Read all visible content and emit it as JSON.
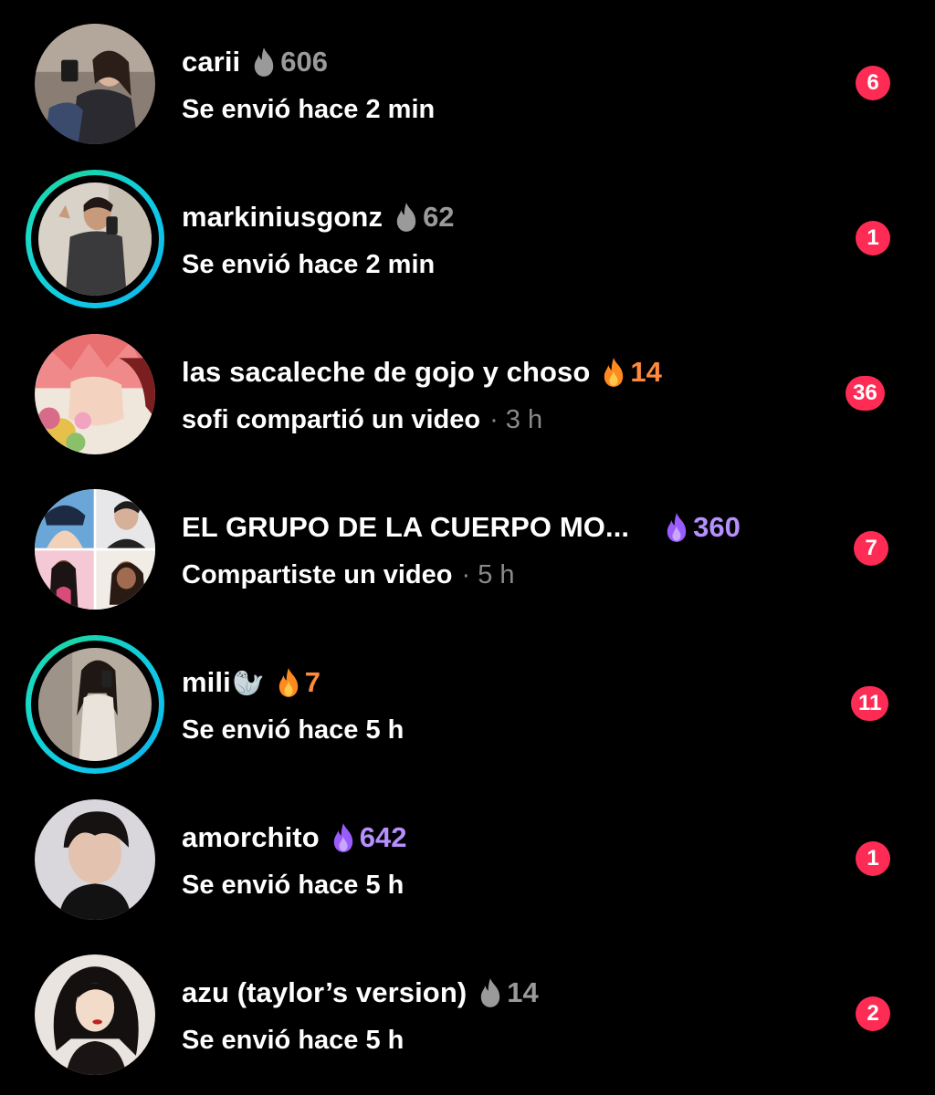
{
  "chats": [
    {
      "name": "carii",
      "streak": "606",
      "streak_color": "gray",
      "status": "Se envió hace 2 min",
      "time": "",
      "badge": "6"
    },
    {
      "name": "markiniusgonz",
      "streak": "62",
      "streak_color": "gray",
      "status": "Se envió hace 2 min",
      "time": "",
      "badge": "1",
      "story_ring": true
    },
    {
      "name": "las sacaleche de gojo y choso",
      "streak": "14",
      "streak_color": "orange",
      "status": "sofi compartió un video",
      "time": "· 3 h",
      "badge": "36"
    },
    {
      "name": "EL GRUPO DE LA CUERPO MO...",
      "streak": "360",
      "streak_color": "purple",
      "status": "Compartiste un video",
      "time": "· 5 h",
      "badge": "7"
    },
    {
      "name": "mili",
      "name_emoji": "🦭",
      "streak": "7",
      "streak_color": "orange",
      "status": "Se envió hace 5 h",
      "time": "",
      "badge": "11",
      "story_ring": true
    },
    {
      "name": "amorchito",
      "streak": "642",
      "streak_color": "purple",
      "status": "Se envió hace 5 h",
      "time": "",
      "badge": "1"
    },
    {
      "name": "azu (taylor’s version)",
      "streak": "14",
      "streak_color": "gray",
      "status": "Se envió hace 5 h",
      "time": "",
      "badge": "2"
    }
  ],
  "colors": {
    "badge": "#fe2c55",
    "streak_gray": "#9a9a9a",
    "streak_orange": "#ff8a3d",
    "streak_purple": "#b690ff",
    "story_ring": "#10c9e6"
  },
  "icons": {
    "streak": "flame-icon"
  }
}
